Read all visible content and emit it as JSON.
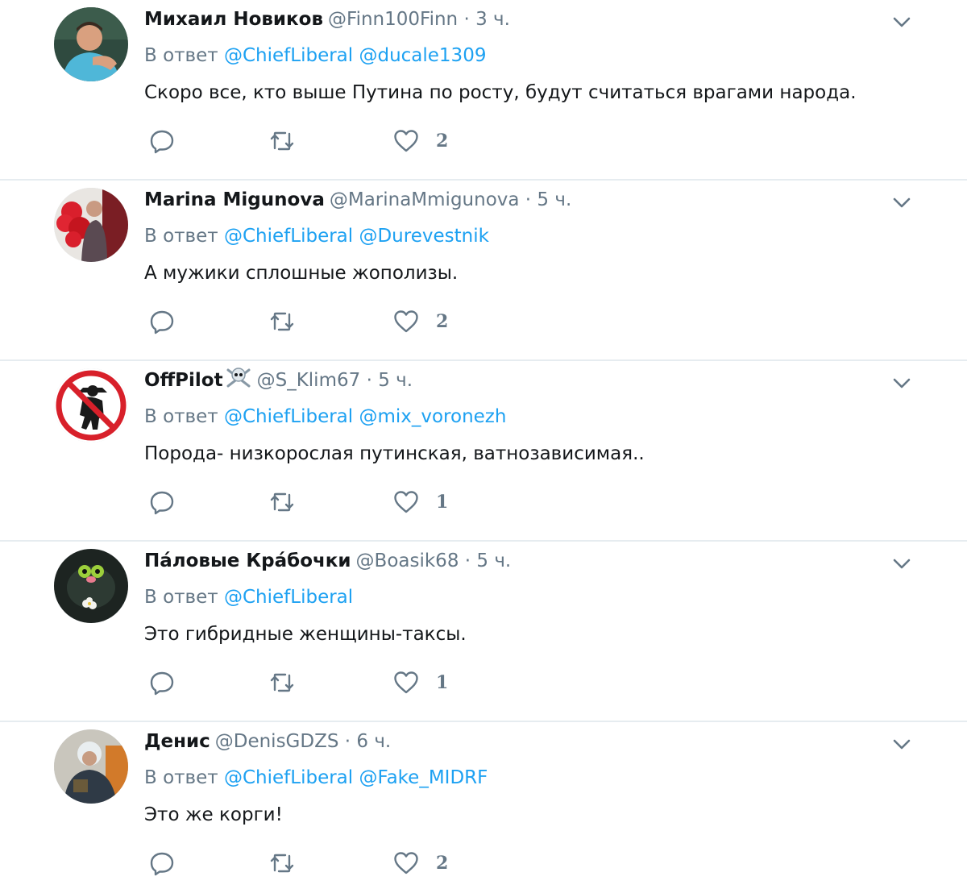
{
  "reply_prefix": "В ответ",
  "tweets": [
    {
      "name": "Михаил Новиков",
      "handle": "@Finn100Finn",
      "dot": "·",
      "time": "3 ч.",
      "mentions": [
        "@ChiefLiberal",
        "@ducale1309"
      ],
      "text": "Скоро все, кто выше Путина по росту, будут считаться врагами народа.",
      "likes": "2"
    },
    {
      "name": "Marina Migunova",
      "handle": "@MarinaMmigunova",
      "dot": "·",
      "time": "5 ч.",
      "mentions": [
        "@ChiefLiberal",
        "@Durevestnik"
      ],
      "text": "А мужики сплошные жополизы.",
      "likes": "2"
    },
    {
      "name": "OffPilot",
      "name_emoji": "skull-crossbones-icon",
      "handle": "@S_Klim67",
      "dot": "·",
      "time": "5 ч.",
      "mentions": [
        "@ChiefLiberal",
        "@mix_voronezh"
      ],
      "text": "Порода- низкорослая путинская, ватнозависимая..",
      "likes": "1"
    },
    {
      "name": "Па́ловые Кра́бочки",
      "handle": "@Boasik68",
      "dot": "·",
      "time": "5 ч.",
      "mentions": [
        "@ChiefLiberal"
      ],
      "text": "Это гибридные женщины-таксы.",
      "likes": "1"
    },
    {
      "name": "Денис",
      "handle": "@DenisGDZS",
      "dot": "·",
      "time": "6 ч.",
      "mentions": [
        "@ChiefLiberal",
        "@Fake_MIDRF"
      ],
      "text": "Это же корги!",
      "likes": "2"
    }
  ],
  "icons": {
    "reply": "reply-icon",
    "retweet": "retweet-icon",
    "like": "heart-icon",
    "menu": "chevron-down-icon"
  },
  "colors": {
    "link": "#1da1f2",
    "secondary": "#657786",
    "text": "#14171a",
    "divider": "#e6ecf0"
  }
}
